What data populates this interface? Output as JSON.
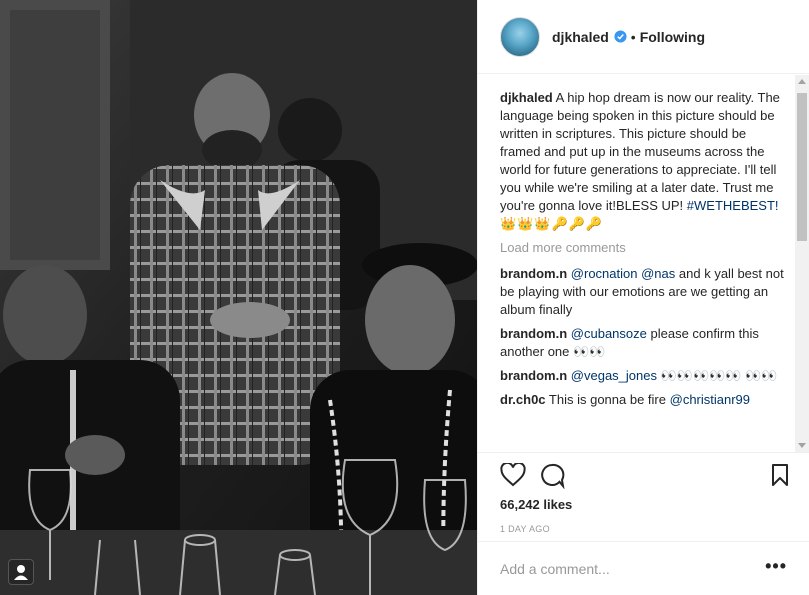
{
  "post": {
    "username": "djkhaled",
    "separator": "•",
    "follow_label": "Following",
    "caption_user": "djkhaled",
    "caption_text": "A hip hop dream is now our reality. The language being spoken in this picture should be written in scriptures. This picture should be framed and put up in the museums across the world for future generations to appreciate. I'll tell you while we're smiling at a later date. Trust me you're gonna love it!BLESS UP!",
    "caption_hashtag": "#WETHEBEST!",
    "caption_emoji": "👑👑👑🔑🔑🔑",
    "load_more": "Load more comments",
    "comments": [
      {
        "user": "brandom.n",
        "mention": "@rocnation",
        "mention2": "@nas",
        "text": "and k yall best not be playing with our emotions are we getting an album finally"
      },
      {
        "user": "brandom.n",
        "mention": "@cubansoze",
        "text": "please confirm this another one 👀👀"
      },
      {
        "user": "brandom.n",
        "mention": "@vegas_jones",
        "text": "👀👀👀👀👀 👀👀"
      },
      {
        "user": "dr.ch0c",
        "text": "This is gonna be fire",
        "mention": "@christianr99"
      }
    ],
    "likes": "66,242 likes",
    "timestamp": "1 DAY AGO",
    "add_comment_placeholder": "Add a comment...",
    "more_options": "•••"
  },
  "colors": {
    "link": "#003569",
    "verified": "#3897f0",
    "muted": "#999999"
  },
  "icons": [
    "verified-badge-icon",
    "heart-icon",
    "comment-icon",
    "bookmark-icon",
    "tagged-user-icon",
    "more-options-icon"
  ]
}
